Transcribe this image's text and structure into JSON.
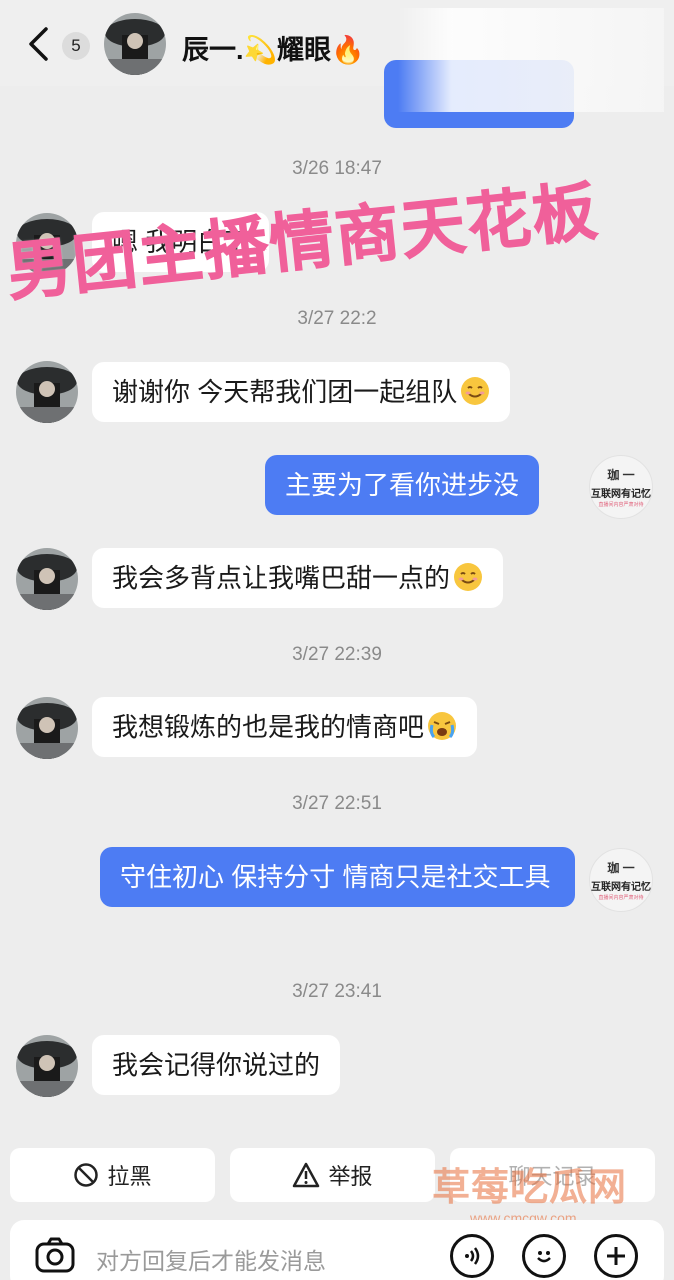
{
  "header": {
    "unread_count": "5",
    "contact_name": "辰一.💫耀眼🔥"
  },
  "overlay_text": "男团主播情商天花板",
  "my_avatar": {
    "line1": "珈 一",
    "line2": "互联网有记忆",
    "line3": "直播间内容严肃对待"
  },
  "messages": [
    {
      "type": "timestamp",
      "text": "3/26 18:47"
    },
    {
      "type": "in",
      "text": "嗯 我明白了"
    },
    {
      "type": "timestamp",
      "text": "3/27 22:2"
    },
    {
      "type": "in",
      "text": "谢谢你 今天帮我们团一起组队",
      "emoji": "smile"
    },
    {
      "type": "out",
      "text": "主要为了看你进步没"
    },
    {
      "type": "in",
      "text": "我会多背点让我嘴巴甜一点的",
      "emoji": "smile"
    },
    {
      "type": "timestamp",
      "text": "3/27 22:39"
    },
    {
      "type": "in",
      "text": "我想锻炼的也是我的情商吧",
      "emoji": "cry"
    },
    {
      "type": "timestamp",
      "text": "3/27 22:51"
    },
    {
      "type": "out",
      "text": "守住初心 保持分寸 情商只是社交工具"
    },
    {
      "type": "timestamp",
      "text": "3/27 23:41"
    },
    {
      "type": "in",
      "text": "我会记得你说过的"
    }
  ],
  "actions": {
    "block_label": "拉黑",
    "report_label": "举报",
    "third_label": "聊天记录"
  },
  "input": {
    "placeholder": "对方回复后才能发消息"
  },
  "watermark": {
    "text": "草莓吃瓜网",
    "url": "www.cmcgw.com"
  },
  "colors": {
    "outgoing_bubble": "#4d7cf3",
    "incoming_bubble": "#ffffff",
    "background": "#ededed",
    "overlay_pink": "#f0609a"
  }
}
